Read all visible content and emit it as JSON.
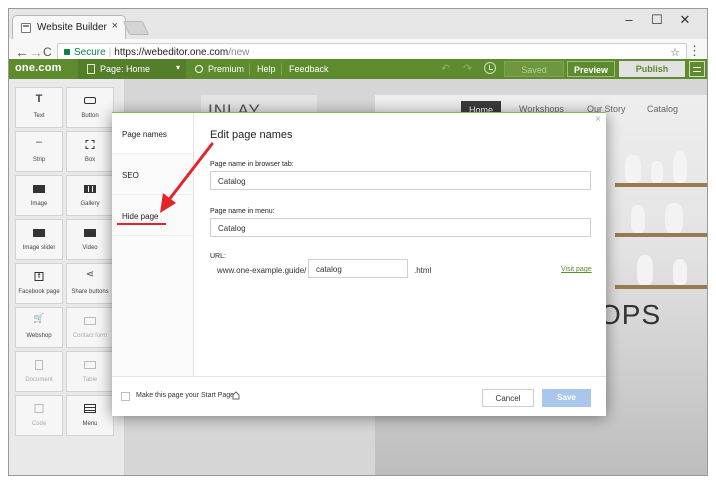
{
  "browser": {
    "tab_title": "Website Builder",
    "tab_close": "×",
    "window_controls": [
      "–",
      "☐",
      "✕"
    ],
    "nav": {
      "back": "←",
      "forward": "→",
      "reload": "C"
    },
    "address": {
      "secure_label": "Secure",
      "separator": "|",
      "url_host": "https://webeditor.one.com",
      "url_path": "/new",
      "star": "☆"
    },
    "menu": "⋮"
  },
  "app_toolbar": {
    "logo": "one.com",
    "page_selector": "Page: Home",
    "page_caret": "▾",
    "premium": "Premium",
    "help": "Help",
    "feedback": "Feedback",
    "undo": "↶",
    "redo": "↷",
    "saved": "Saved",
    "preview": "Preview",
    "publish": "Publish"
  },
  "widgets": [
    {
      "label": "Text",
      "icon": "T",
      "enabled": true
    },
    {
      "label": "Button",
      "icon": "▭",
      "enabled": true
    },
    {
      "label": "Strip",
      "icon": "–",
      "enabled": true
    },
    {
      "label": "Box",
      "icon": "⌗",
      "enabled": true
    },
    {
      "label": "Image",
      "icon": "▣",
      "enabled": true
    },
    {
      "label": "Gallery",
      "icon": "▦",
      "enabled": true
    },
    {
      "label": "Image slider",
      "icon": "▣",
      "enabled": true
    },
    {
      "label": "Video",
      "icon": "▶",
      "enabled": true
    },
    {
      "label": "Facebook page",
      "icon": "f",
      "enabled": true
    },
    {
      "label": "Share buttons",
      "icon": "⋖",
      "enabled": true
    },
    {
      "label": "Webshop",
      "icon": "🛒",
      "enabled": true
    },
    {
      "label": "Contact form",
      "icon": "▤",
      "enabled": false
    },
    {
      "label": "Document",
      "icon": "▯",
      "enabled": false
    },
    {
      "label": "Table",
      "icon": "▦",
      "enabled": false
    },
    {
      "label": "Code",
      "icon": "▢",
      "enabled": false
    },
    {
      "label": "Menu",
      "icon": "☰",
      "enabled": true
    }
  ],
  "site": {
    "logo_text": "INLAY",
    "nav": [
      "Home",
      "Workshops",
      "Our Story",
      "Catalog"
    ],
    "hero_text": "OPS"
  },
  "modal": {
    "sidebar": [
      "Page names",
      "SEO",
      "Hide page"
    ],
    "close": "×",
    "title": "Edit page names",
    "browser_tab_label": "Page name in browser tab:",
    "browser_tab_value": "Catalog",
    "menu_label": "Page name in menu:",
    "menu_value": "Catalog",
    "url_label": "URL:",
    "url_prefix": "www.one-example.guide/",
    "url_slug": "catalog",
    "url_suffix": ".html",
    "visit_link": "Visit page",
    "start_page_label": "Make this page your Start Page",
    "cancel": "Cancel",
    "save": "Save"
  },
  "colors": {
    "brand_green": "#5f8b2f",
    "annotation_red": "#e3242b",
    "save_disabled_blue": "#a9c7eb"
  }
}
